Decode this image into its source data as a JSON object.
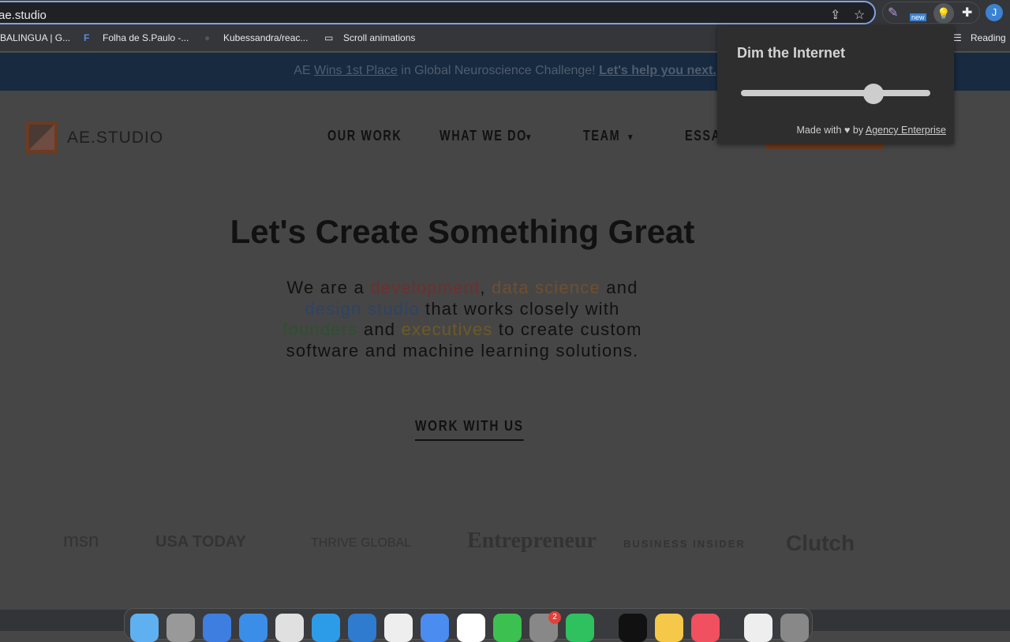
{
  "browser": {
    "url": "ae.studio",
    "avatar_initial": "J",
    "ext_badge": "new",
    "bookmarks": [
      "BALINGUA | G...",
      "Folha de S.Paulo -...",
      "Kubessandra/reac...",
      "Scroll animations"
    ],
    "reading_list": "Reading"
  },
  "banner": {
    "prefix": "AE ",
    "link1": "Wins 1st Place",
    "middle": " in Global Neuroscience Challenge! ",
    "link2": "Let's help you next."
  },
  "header": {
    "logo": "AE.STUDIO",
    "nav": [
      "OUR WORK",
      "WHAT WE DO",
      "TEAM",
      "ESSAYS"
    ]
  },
  "hero": {
    "title": "Let's Create Something Great",
    "sub": {
      "t1": "We are a ",
      "dev": "development",
      ", ": ", ",
      "ds": "data science",
      "t2": " and ",
      "design": "design studio",
      "t3": " that works closely with ",
      "founders": "founders",
      "t4": " and ",
      "exec": "executives",
      "t5": " to create custom software and machine learning solutions."
    },
    "cta": "WORK WITH US"
  },
  "press": [
    "msn",
    "USA TODAY",
    "THRIVE GLOBAL",
    "Entrepreneur",
    "BUSINESS INSIDER",
    "Clutch"
  ],
  "popup": {
    "title": "Dim the Internet",
    "slider_value_percent": 70,
    "foot_prefix": "Made with ",
    "foot_by": " by ",
    "foot_link": "Agency Enterprise"
  },
  "dock": {
    "badge": "2",
    "apps": [
      "finder",
      "launchpad",
      "mail",
      "safari",
      "chrome",
      "docker",
      "vscode",
      "slack",
      "zoom",
      "mongodb",
      "whatsapp",
      "system-preferences",
      "spotify",
      "terminal",
      "notes",
      "music",
      "preview",
      "trash"
    ]
  }
}
